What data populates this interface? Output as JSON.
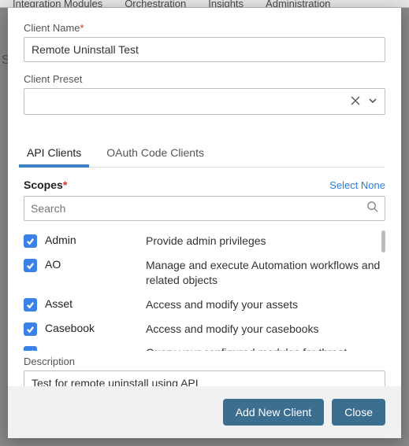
{
  "top_nav": [
    "Integration Modules",
    "Orchestration",
    "Insights",
    "Administration"
  ],
  "left_char": "S",
  "client_name": {
    "label": "Client Name",
    "value": "Remote Uninstall Test"
  },
  "client_preset": {
    "label": "Client Preset",
    "value": ""
  },
  "tabs": {
    "active": "API Clients",
    "items": [
      "API Clients",
      "OAuth Code Clients"
    ]
  },
  "scopes": {
    "title": "Scopes",
    "select_none": "Select None",
    "search_placeholder": "Search",
    "items": [
      {
        "name": "Admin",
        "desc": "Provide admin privileges",
        "checked": true
      },
      {
        "name": "AO",
        "desc": "Manage and execute Automation workflows and related objects",
        "checked": true
      },
      {
        "name": "Asset",
        "desc": "Access and modify your assets",
        "checked": true
      },
      {
        "name": "Casebook",
        "desc": "Access and modify your casebooks",
        "checked": true
      },
      {
        "name": "",
        "desc": "Query your configured modules for threat",
        "checked": true
      }
    ]
  },
  "description": {
    "label": "Description",
    "value": "Test for remote uninstall using API"
  },
  "footer": {
    "add": "Add New Client",
    "close": "Close"
  }
}
